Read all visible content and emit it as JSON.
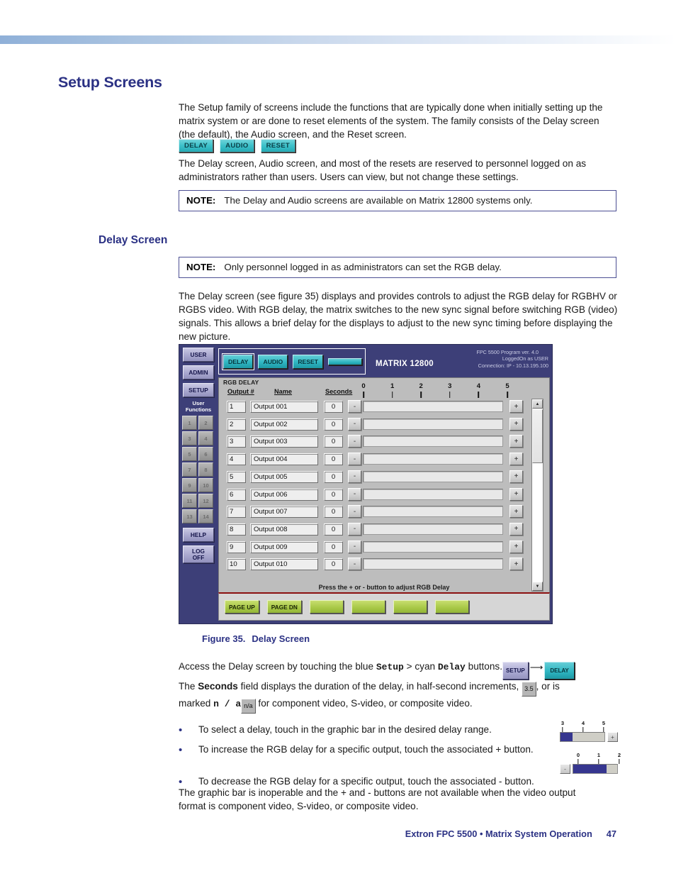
{
  "page": {
    "title": "Setup Screens",
    "section_title": "Delay Screen",
    "paragraph_intro": "The Setup family of screens include the functions that are typically done when initially setting up the matrix system or are done to reset elements of the system. The family consists of the Delay screen (the default), the Audio screen, and the Reset screen.",
    "paragraph_admins": "The Delay screen, Audio screen, and most of the resets are reserved to personnel logged on as administrators rather than users. Users can view, but not change these settings.",
    "paragraph_delayscreen": "The Delay screen (see figure 35) displays and provides controls to adjust the RGB delay for RGBHV or RGBS video. With RGB delay, the matrix switches to the new sync signal before switching RGB (video) signals. This allows a brief delay for the displays to adjust to the new sync timing before displaying the new picture.",
    "paragraph_final": "The graphic bar is inoperable and the + and - buttons are not available when the video output format is component video, S-video, or composite video."
  },
  "notes": [
    {
      "label": "NOTE:",
      "text": "The Delay and Audio screens are available on Matrix 12800 systems only."
    },
    {
      "label": "NOTE:",
      "text": "Only personnel logged in as administrators can set the RGB delay."
    }
  ],
  "inline_tabs": [
    {
      "label": "DELAY"
    },
    {
      "label": "AUDIO"
    },
    {
      "label": "RESET"
    }
  ],
  "figure": {
    "caption_label": "Figure 35.",
    "caption_title": "Delay Screen",
    "header": {
      "tabs": [
        {
          "label": "DELAY",
          "active": true
        },
        {
          "label": "AUDIO",
          "active": false
        },
        {
          "label": "RESET",
          "active": false
        },
        {
          "label": "",
          "active": false
        }
      ],
      "matrix_label": "MATRIX 12800",
      "info_line1": "FPC 5500 Program  ver. 4.0",
      "info_line2": "LoggedOn as USER",
      "info_line3": "Connection: IP - 10.13.195.100"
    },
    "sidebar": {
      "buttons": [
        {
          "label": "USER"
        },
        {
          "label": "ADMIN"
        },
        {
          "label": "SETUP"
        }
      ],
      "functions_label_line1": "User",
      "functions_label_line2": "Functions",
      "function_numbers": [
        "1",
        "2",
        "3",
        "4",
        "5",
        "6",
        "7",
        "8",
        "9",
        "10",
        "11",
        "12",
        "13",
        "14"
      ],
      "help_label": "HELP",
      "logoff_line1": "LOG",
      "logoff_line2": "OFF"
    },
    "panel": {
      "legend": "RGB DELAY",
      "columns": [
        "Output #",
        "Name",
        "Seconds"
      ],
      "scale_ticks": [
        "0",
        "1",
        "2",
        "3",
        "4",
        "5"
      ],
      "minus_label": "-",
      "plus_label": "+",
      "rows": [
        {
          "num": "1",
          "name": "Output 001",
          "seconds": "0"
        },
        {
          "num": "2",
          "name": "Output 002",
          "seconds": "0"
        },
        {
          "num": "3",
          "name": "Output 003",
          "seconds": "0"
        },
        {
          "num": "4",
          "name": "Output 004",
          "seconds": "0"
        },
        {
          "num": "5",
          "name": "Output 005",
          "seconds": "0"
        },
        {
          "num": "6",
          "name": "Output 006",
          "seconds": "0"
        },
        {
          "num": "7",
          "name": "Output 007",
          "seconds": "0"
        },
        {
          "num": "8",
          "name": "Output 008",
          "seconds": "0"
        },
        {
          "num": "9",
          "name": "Output 009",
          "seconds": "0"
        },
        {
          "num": "10",
          "name": "Output 010",
          "seconds": "0"
        }
      ]
    },
    "status_text": "Press the + or  -  button to adjust RGB Delay",
    "footer_buttons": [
      {
        "label": "PAGE UP"
      },
      {
        "label": "PAGE DN"
      },
      {
        "label": ""
      },
      {
        "label": ""
      },
      {
        "label": ""
      },
      {
        "label": ""
      }
    ]
  },
  "access_text": {
    "part1": "Access the Delay screen by touching the blue ",
    "setup_word": "Setup",
    "part2": " > cyan ",
    "delay_word": "Delay",
    "part3": " buttons.",
    "line2_part1": "The ",
    "seconds_word": "Seconds",
    "line2_part2": " field displays the duration of the delay, in half-second increments, ",
    "seconds_example": "3.5",
    "line2_part3": ", or is",
    "line3_part1": "marked ",
    "na_word": "n / a",
    "na_example": "n/a",
    "line3_part2": " for component video, S-video, or composite video.",
    "inline_setup_button": "SETUP",
    "inline_delay_button": "DELAY"
  },
  "bullets": [
    "To select a delay, touch in the graphic bar in the desired delay range.",
    "To increase the RGB delay for a specific output, touch the associated + button.",
    "To decrease the RGB delay for a specific output, touch the associated - button."
  ],
  "mini_graphics": {
    "top": {
      "ticks": [
        "3",
        "4",
        "5"
      ],
      "fill_percent": 28,
      "button": "+"
    },
    "bottom": {
      "ticks": [
        "0",
        "1",
        "2"
      ],
      "fill_percent": 76,
      "button": "-"
    }
  },
  "footer": {
    "text": "Extron FPC 5500 • Matrix System Operation",
    "page_number": "47"
  },
  "colors": {
    "heading_blue": "#2b3184",
    "note_border": "#4c4f93",
    "cyan_button": "#2fb6c2",
    "figure_bg": "#3d3f78",
    "panel_gray": "#bdbdbd",
    "green_button": "#a9c948",
    "bar_fill_blue": "#36368f"
  }
}
